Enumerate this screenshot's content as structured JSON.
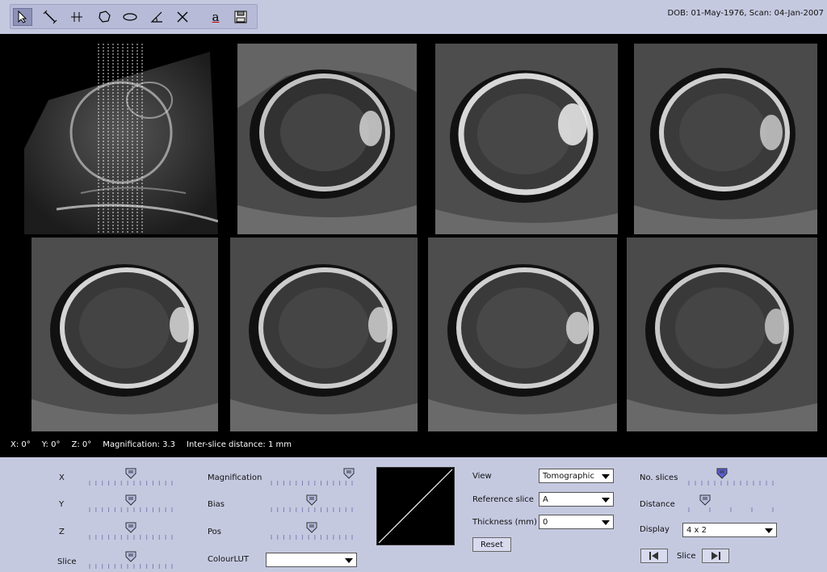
{
  "header": {
    "info": "DOB: 01-May-1976, Scan: 04-Jan-2007"
  },
  "toolbar": {
    "tools": [
      {
        "icon": "pointer-icon",
        "active": true
      },
      {
        "icon": "line-measure-icon",
        "active": false
      },
      {
        "icon": "crosshair-icon",
        "active": false
      },
      {
        "icon": "freehand-region-icon",
        "active": false
      },
      {
        "icon": "ellipse-icon",
        "active": false
      },
      {
        "icon": "angle-icon",
        "active": false
      },
      {
        "icon": "delete-marker-icon",
        "active": false
      },
      {
        "icon": "annotate-text-icon",
        "active": false
      },
      {
        "icon": "save-disk-icon",
        "active": false
      }
    ],
    "annotate_glyph": "a"
  },
  "viewer": {
    "status": {
      "x": "X: 0°",
      "y": "Y: 0°",
      "z": "Z: 0°",
      "magnification": "Magnification: 3.3",
      "spacing": "Inter-slice distance: 1 mm"
    }
  },
  "controls": {
    "rotation": {
      "x_label": "X",
      "y_label": "Y",
      "z_label": "Z",
      "slice_label": "Slice",
      "x_value": 0.5,
      "y_value": 0.5,
      "z_value": 0.5,
      "slice_value": 0.5
    },
    "image": {
      "magnification_label": "Magnification",
      "bias_label": "Bias",
      "pos_label": "Pos",
      "colour_lut_label": "ColourLUT",
      "colour_lut_value": "",
      "magnification_value": 0.95,
      "bias_value": 0.5,
      "pos_value": 0.5
    },
    "view": {
      "view_label": "View",
      "view_value": "Tomographic",
      "reference_slice_label": "Reference slice",
      "reference_slice_value": "A",
      "thickness_label": "Thickness (mm)",
      "thickness_value": "0",
      "reset_label": "Reset"
    },
    "layout": {
      "no_slices_label": "No. slices",
      "no_slices_value": 0.4,
      "distance_label": "Distance",
      "distance_value": 0.2,
      "display_label": "Display",
      "display_value": "4 x 2",
      "slice_nav_label": "Slice"
    }
  },
  "colors": {
    "panel_bg": "#c5c9e0",
    "viewer_bg": "#000000",
    "thumb_fill": "#b9bde0",
    "active_thumb_fill": "#5a5fd0"
  }
}
